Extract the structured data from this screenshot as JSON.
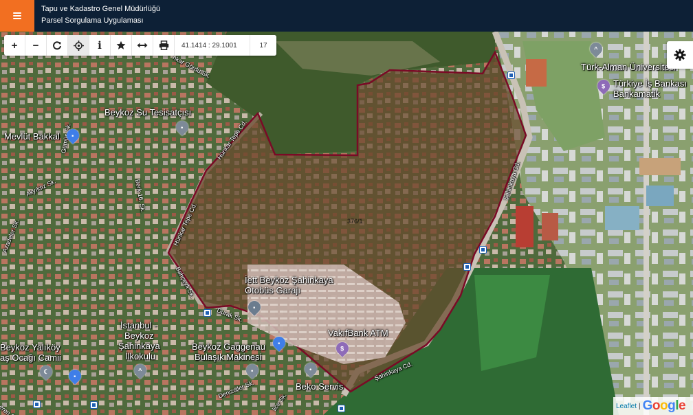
{
  "header": {
    "org_title": "Tapu ve Kadastro Genel Müdürlüğü",
    "app_title": "Parsel Sorgulama Uygulaması"
  },
  "toolbar": {
    "zoom_in_label": "+",
    "zoom_out_label": "−",
    "info_label": "i",
    "coordinates_value": "41.1414 : 29.1001",
    "zoom_level_value": "17"
  },
  "parcel": {
    "label": "376/1"
  },
  "map_labels": {
    "su_tesisatcisi": "Beykoz Su Tesisatçısı",
    "mevlut_bakkal": "Mevlüt Bakkal",
    "iett_1": "İett Beykoz Şahinkaya",
    "iett_2": "Otobüs Garajı",
    "vakifbank": "VakıfBank ATM",
    "turk_alman": "Türk-Alman Üniversitesi",
    "is_bankasi_1": "Türkiye İş Bankası",
    "is_bankasi_2": "Bankamatik",
    "istanbul_1": "İstanbul -",
    "istanbul_2": "Beykoz",
    "istanbul_3": "Şahinkaya",
    "istanbul_4": "İlkokulu",
    "gaggenau_1": "Beykoz Gaggenau",
    "gaggenau_2": "Bulaşık Makinesi",
    "yalikoy_1": "Beykoz Yalıköy",
    "yalikoy_2": "aş Ocağı Camii",
    "beko": "Beko Servis",
    "hunkar_gordu": "nkar Gördü Sk.",
    "hunkar_tepe_1": "Hünkar Tepe Cd.",
    "hunkar_tepe_2": "Hünkar Tepe Cd.",
    "gumus": "Gümüş Sk.",
    "akyildiz": "Akyıldız Sk.",
    "berk": "Berk 16. Sk.",
    "azadeler": "Azadeler Sk.",
    "bahcevli": "Bahçevli Sk.",
    "durak": "Durak Sk.",
    "sahinkaya_1": "Şahinkaya Cd.",
    "sahinkaya_2": "Şahinkaya Cd.",
    "denizciler": "Denizciler Sk.",
    "ilice": "lice Sk.",
    "eren": "eren Sk."
  },
  "attribution": {
    "leaflet": "Leaflet",
    "separator": "|"
  },
  "colors": {
    "header_bg": "#0d2036",
    "menu_accent": "#f26f21",
    "parcel_outline": "#7a0a26"
  }
}
